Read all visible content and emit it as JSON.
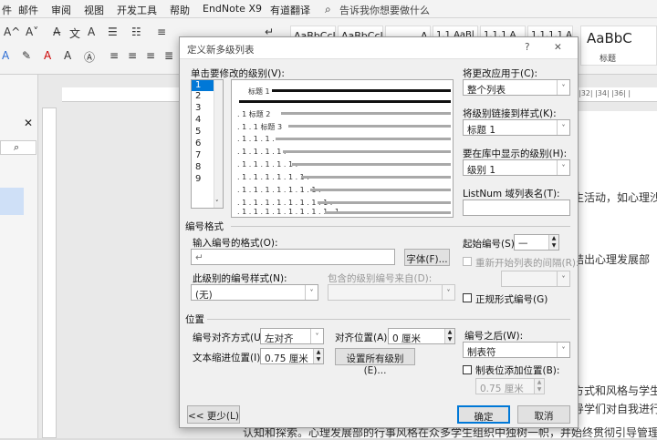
{
  "menu": [
    "件",
    "邮件",
    "审阅",
    "视图",
    "开发工具",
    "帮助",
    "EndNote X9",
    "有道翻译"
  ],
  "tell_me": "告诉我你想要做什么",
  "ribbon": {
    "styles": [
      "AaBbCcI",
      "AaBbCcI",
      "A",
      "1.1 AaBl",
      "1.1.1 A",
      "1.1.1.1 A",
      "AaBbC"
    ],
    "style_caption": "标题"
  },
  "doc": {
    "lines": [
      "生活动，如心理沙",
      "结出心理发展部",
      "方式和风格与学生",
      "引导学们对自我进行",
      "认知和探索。心理发展部的行事风格在众多学生组织中独树一帜，并始终贯彻引导管理"
    ],
    "ruler_marks": "|32|  |34|  |36|  |",
    "left_search_icon": "⌕"
  },
  "dialog": {
    "title": "定义新多级列表",
    "help": "?",
    "close": "✕",
    "level_label": "单击要修改的级别(V):",
    "levels": [
      "1",
      "2",
      "3",
      "4",
      "5",
      "6",
      "7",
      "8",
      "9"
    ],
    "preview": {
      "heading1": "标题 1",
      "rows": [
        ". 1  标题 2",
        ". 1 . 1  标题 3",
        ". 1 . 1 . 1 .",
        ". 1 . 1 . 1 . 1 .",
        ". 1 . 1 . 1 . 1 . 1 .",
        ". 1 . 1 . 1 . 1 . 1 . 1 .",
        ". 1 . 1 . 1 . 1 . 1 . 1 . 1 .",
        ". 1 . 1 . 1 . 1 . 1 . 1 . 1 . 1 .",
        ". 1 . 1 . 1 . 1 . 1 . 1 . 1 . 1 . 1 ."
      ]
    },
    "apply_to_label": "将更改应用于(C):",
    "apply_to_value": "整个列表",
    "link_style_label": "将级别链接到样式(K):",
    "link_style_value": "标题 1",
    "gallery_level_label": "要在库中显示的级别(H):",
    "gallery_level_value": "级别 1",
    "listnum_label": "ListNum 域列表名(T):",
    "listnum_value": "",
    "number_format_section": "编号格式",
    "enter_format_label": "输入编号的格式(O):",
    "format_value": "↵",
    "font_button": "字体(F)...",
    "start_at_label": "起始编号(S):",
    "start_at_value": "—",
    "restart_label": "重新开始列表的间隔(R):",
    "number_style_label": "此级别的编号样式(N):",
    "number_style_value": "(无)",
    "include_from_label": "包含的级别编号来自(D):",
    "legal_label": "正规形式编号(G)",
    "position_section": "位置",
    "align_label": "编号对齐方式(U):",
    "align_value": "左对齐",
    "align_at_label": "对齐位置(A):",
    "align_at_value": "0 厘米",
    "follow_label": "编号之后(W):",
    "follow_value": "制表符",
    "indent_label": "文本缩进位置(I):",
    "indent_value": "0.75 厘米",
    "set_all_button": "设置所有级别(E)...",
    "tab_stop_label": "制表位添加位置(B):",
    "tab_stop_value": "0.75 厘米",
    "less_button": "<< 更少(L)",
    "ok_button": "确定",
    "cancel_button": "取消"
  },
  "colors": {
    "accent": "#0078d7",
    "select": "#0078d7",
    "highlight": "#cce4f7"
  }
}
